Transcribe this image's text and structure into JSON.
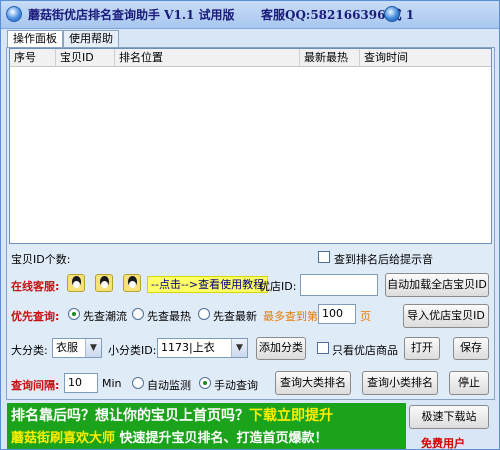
{
  "window": {
    "title": "蘑菇街优店排名查询助手  V1.1  试用版",
    "qq_label": "客服QQ:582166396 或 1"
  },
  "tabs": [
    {
      "label": "操作面板",
      "active": true
    },
    {
      "label": "使用帮助",
      "active": false
    }
  ],
  "grid": {
    "columns": [
      "序号",
      "宝贝ID",
      "排名位置",
      "最新最热",
      "查询时间"
    ],
    "rows": []
  },
  "form": {
    "item_id_label": "宝贝ID个数:",
    "notify_checkbox_label": "查到排名后给提示音",
    "online_service_label": "在线客服:",
    "tutorial_link": "--点击-->查看使用教程",
    "shop_id_label": "优店ID:",
    "shop_id_value": "",
    "auto_load_button": "自动加载全店宝贝ID",
    "priority_label": "优先查询:",
    "priority_options": [
      "先查潮流",
      "先查最热",
      "先查最新"
    ],
    "priority_selected": 0,
    "max_query_label": "最多查到第",
    "max_query_value": "100",
    "page_unit": "页",
    "import_button": "导入优店宝贝ID",
    "category_label": "大分类:",
    "category_value": "衣服",
    "subcategory_label": "小分类ID:",
    "subcategory_value": "1173|上衣",
    "add_category_button": "添加分类",
    "shop_only_checkbox_label": "只看优店商品",
    "open_button": "打开",
    "save_button": "保存",
    "interval_label": "查询间隔:",
    "interval_value": "10",
    "interval_unit": "Min",
    "mode_options": [
      "自动监测",
      "手动查询"
    ],
    "mode_selected": 1,
    "query_major_button": "查询大类排名",
    "query_minor_button": "查询小类排名",
    "stop_button": "停止"
  },
  "banner": {
    "line1_prefix": "排名靠后吗？想让你的宝贝上首页吗？",
    "line1_highlight": "下载立即提升",
    "line2_prefix": "蘑菇街刷喜欢大师",
    "line2_suffix": " 快速提升宝贝排名、打造首页爆款！"
  },
  "watermark": "极速下载站",
  "free_user_label": "免费用户",
  "colors": {
    "title": "#1a1a7a",
    "banner_bg": "#1ba31b",
    "label_red": "#c81010",
    "label_orange": "#e87a00"
  }
}
